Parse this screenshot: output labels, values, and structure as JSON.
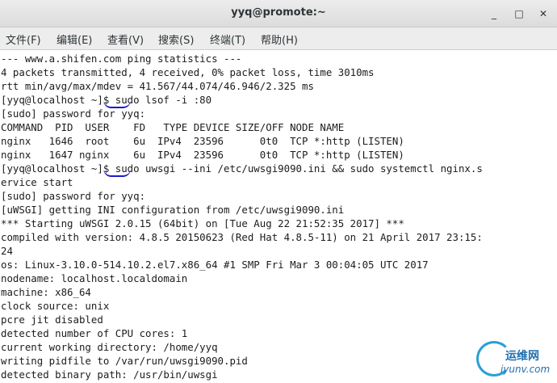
{
  "window": {
    "title": "yyq@promote:~",
    "minimize_glyph": "_",
    "maximize_glyph": "□",
    "close_glyph": "✕"
  },
  "menu": [
    {
      "label": "文件(F)"
    },
    {
      "label": "编辑(E)"
    },
    {
      "label": "查看(V)"
    },
    {
      "label": "搜索(S)"
    },
    {
      "label": "终端(T)"
    },
    {
      "label": "帮助(H)"
    }
  ],
  "terminal": {
    "lines": [
      "--- www.a.shifen.com ping statistics ---",
      "4 packets transmitted, 4 received, 0% packet loss, time 3010ms",
      "rtt min/avg/max/mdev = 41.567/44.074/46.946/2.325 ms",
      "[yyq@localhost ~]$ sudo lsof -i :80",
      "[sudo] password for yyq:",
      "COMMAND  PID  USER    FD   TYPE DEVICE SIZE/OFF NODE NAME",
      "nginx   1646  root    6u  IPv4  23596      0t0  TCP *:http (LISTEN)",
      "nginx   1647 nginx    6u  IPv4  23596      0t0  TCP *:http (LISTEN)",
      "[yyq@localhost ~]$ sudo uwsgi --ini /etc/uwsgi9090.ini && sudo systemctl nginx.s",
      "ervice start",
      "[sudo] password for yyq:",
      "[uWSGI] getting INI configuration from /etc/uwsgi9090.ini",
      "*** Starting uWSGI 2.0.15 (64bit) on [Tue Aug 22 21:52:35 2017] ***",
      "compiled with version: 4.8.5 20150623 (Red Hat 4.8.5-11) on 21 April 2017 23:15:",
      "24",
      "os: Linux-3.10.0-514.10.2.el7.x86_64 #1 SMP Fri Mar 3 00:04:05 UTC 2017",
      "nodename: localhost.localdomain",
      "machine: x86_64",
      "clock source: unix",
      "pcre jit disabled",
      "detected number of CPU cores: 1",
      "current working directory: /home/yyq",
      "writing pidfile to /var/run/uwsgi9090.pid",
      "detected binary path: /usr/bin/uwsgi"
    ]
  },
  "watermark": {
    "cn": "运维网",
    "en": "iyunv.com"
  },
  "colors": {
    "annotation": "#1a1ad0",
    "watermark": "#1f6fb2"
  }
}
